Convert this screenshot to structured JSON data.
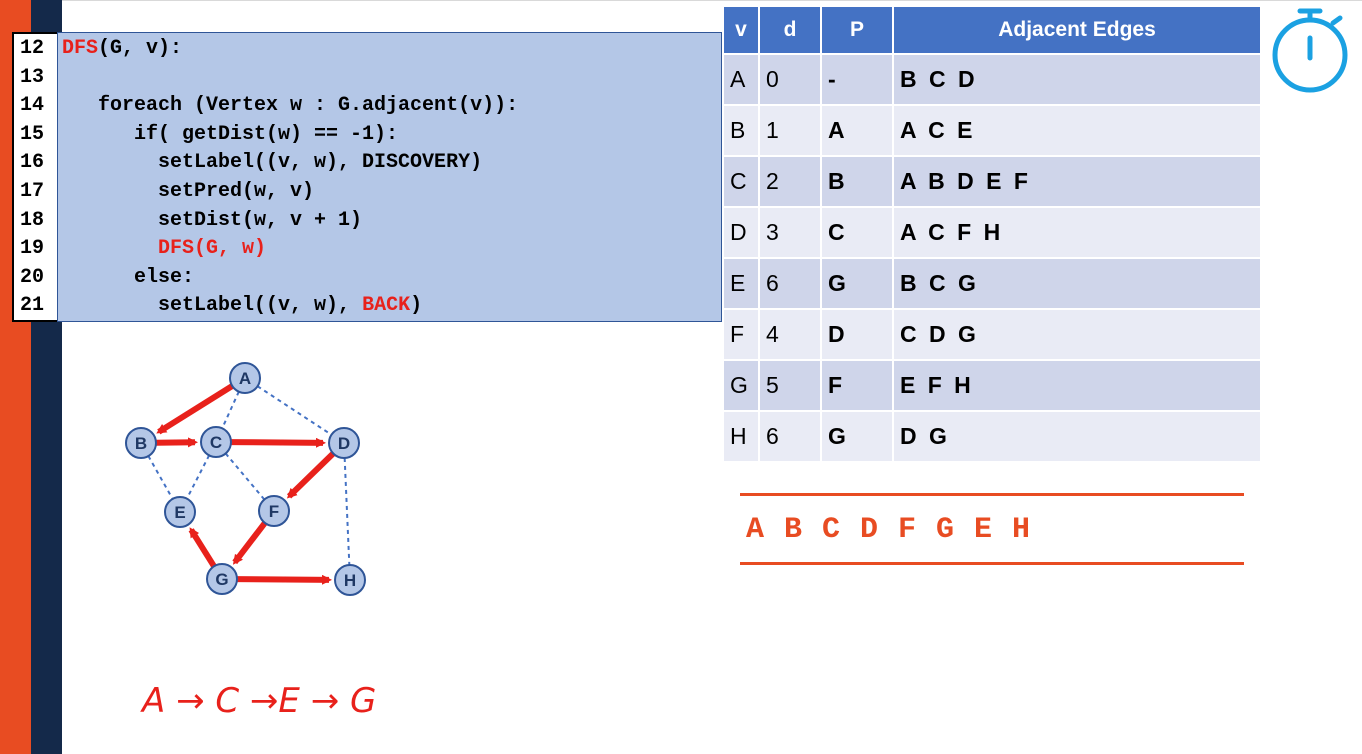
{
  "code": {
    "lines": [
      {
        "num": "12",
        "segments": [
          {
            "text": "DFS",
            "color": "red"
          },
          {
            "text": "(G, v):",
            "color": "black"
          }
        ]
      },
      {
        "num": "13",
        "segments": []
      },
      {
        "num": "14",
        "segments": [
          {
            "text": "   foreach (Vertex w : G.adjacent(v)):",
            "color": "black"
          }
        ]
      },
      {
        "num": "15",
        "segments": [
          {
            "text": "      if( getDist(w) == -1):",
            "color": "black"
          }
        ]
      },
      {
        "num": "16",
        "segments": [
          {
            "text": "        setLabel((v, w), DISCOVERY)",
            "color": "black"
          }
        ]
      },
      {
        "num": "17",
        "segments": [
          {
            "text": "        setPred(w, v)",
            "color": "black"
          }
        ]
      },
      {
        "num": "18",
        "segments": [
          {
            "text": "        setDist(w, v + 1)",
            "color": "black"
          }
        ]
      },
      {
        "num": "19",
        "segments": [
          {
            "text": "        DFS(G, w)",
            "color": "red"
          }
        ]
      },
      {
        "num": "20",
        "segments": [
          {
            "text": "      else:",
            "color": "black"
          }
        ]
      },
      {
        "num": "21",
        "segments": [
          {
            "text": "        setLabel((v, w), ",
            "color": "black"
          },
          {
            "text": "BACK",
            "color": "red"
          },
          {
            "text": ")",
            "color": "black"
          }
        ]
      }
    ]
  },
  "table": {
    "headers": {
      "v": "v",
      "d": "d",
      "p": "P",
      "edges": "Adjacent Edges"
    },
    "rows": [
      {
        "v": "A",
        "d": "0",
        "p": "-",
        "edges": "B C D"
      },
      {
        "v": "B",
        "d": "1",
        "p": "A",
        "edges": "A C E"
      },
      {
        "v": "C",
        "d": "2",
        "p": "B",
        "edges": "A B D E F"
      },
      {
        "v": "D",
        "d": "3",
        "p": "C",
        "edges": "A C F H"
      },
      {
        "v": "E",
        "d": "6",
        "p": "G",
        "edges": "B C G"
      },
      {
        "v": "F",
        "d": "4",
        "p": "D",
        "edges": "C D G"
      },
      {
        "v": "G",
        "d": "5",
        "p": "F",
        "edges": "E F H"
      },
      {
        "v": "H",
        "d": "6",
        "p": "G",
        "edges": "D G"
      }
    ]
  },
  "traversal_order": "A B C D F G E H",
  "handwritten_note": "A → C →E → G",
  "graph": {
    "nodes": [
      "A",
      "B",
      "C",
      "D",
      "E",
      "F",
      "G",
      "H"
    ],
    "discovery_edges": [
      [
        "A",
        "B"
      ],
      [
        "B",
        "C"
      ],
      [
        "C",
        "D"
      ],
      [
        "D",
        "F"
      ],
      [
        "F",
        "G"
      ],
      [
        "G",
        "E"
      ],
      [
        "G",
        "H"
      ]
    ],
    "back_edges": [
      [
        "A",
        "C"
      ],
      [
        "A",
        "D"
      ],
      [
        "B",
        "E"
      ],
      [
        "C",
        "E"
      ],
      [
        "C",
        "F"
      ],
      [
        "D",
        "H"
      ]
    ]
  },
  "colors": {
    "accent_orange": "#E84C22",
    "navy": "#14294A",
    "code_red": "#E8211B",
    "header_blue": "#4472C4",
    "node_fill": "#B4C7E7",
    "timer_blue": "#1BA1E2",
    "discovery_edge": "#E8211B",
    "back_edge": "#4472C4"
  },
  "icons": {
    "timer": "stopwatch-icon"
  }
}
